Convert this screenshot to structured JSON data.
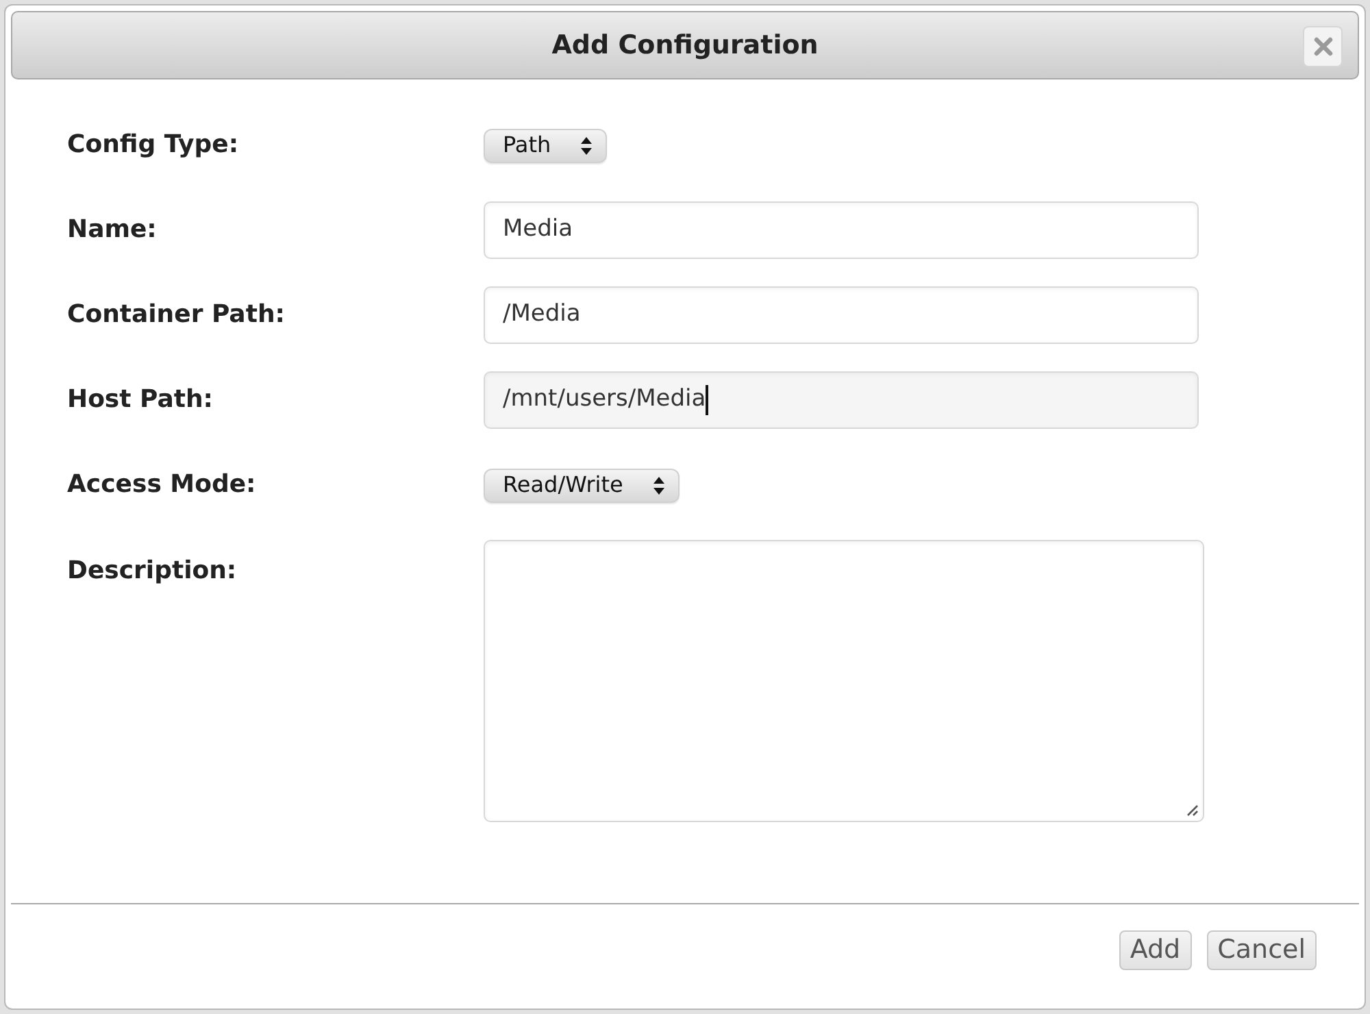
{
  "dialog": {
    "title": "Add Configuration"
  },
  "form": {
    "rows": [
      {
        "kind": "select",
        "label": "Config Type:",
        "value": "Path"
      },
      {
        "kind": "text",
        "label": "Name:",
        "value": "Media",
        "focused": false
      },
      {
        "kind": "text",
        "label": "Container Path:",
        "value": "/Media",
        "focused": false
      },
      {
        "kind": "text",
        "label": "Host Path:",
        "value": "/mnt/users/Media",
        "focused": true
      },
      {
        "kind": "select",
        "label": "Access Mode:",
        "value": "Read/Write"
      },
      {
        "kind": "textarea",
        "label": "Description:"
      }
    ]
  },
  "buttons": [
    "Add",
    "Cancel"
  ]
}
